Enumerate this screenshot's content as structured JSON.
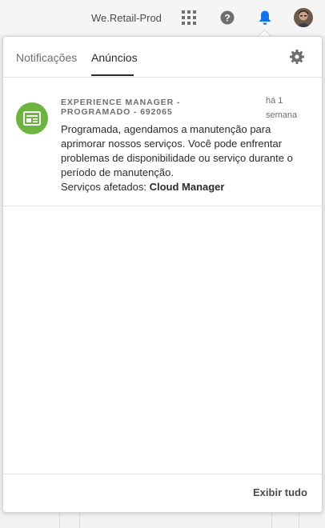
{
  "header": {
    "org_name": "We.Retail-Prod",
    "apps_icon": "apps-grid-icon",
    "help_icon": "help-icon",
    "bell_icon": "bell-icon",
    "avatar_icon": "user-avatar"
  },
  "colors": {
    "bell": "#1473e6",
    "help": "#6e6e6e",
    "item_icon_bg": "#6db33f",
    "text": "#2c2c2c",
    "muted": "#6e6e6e"
  },
  "popover": {
    "tabs": [
      {
        "label": "Notificações",
        "selected": false
      },
      {
        "label": "Anúncios",
        "selected": true
      }
    ],
    "settings_icon": "gear-icon",
    "announcements": [
      {
        "icon": "announcement-icon",
        "source": "EXPERIENCE MANAGER - PROGRAMADO - 692065",
        "time": "há 1 semana",
        "body": "Programada, agendamos a manutenção para aprimorar nossos serviços. Você pode enfrentar problemas de disponibilidade ou serviço durante o período de manutenção.",
        "affected_label": "Serviços afetados:",
        "affected_value": "Cloud Manager"
      }
    ],
    "footer": {
      "view_all_label": "Exibir tudo"
    }
  }
}
